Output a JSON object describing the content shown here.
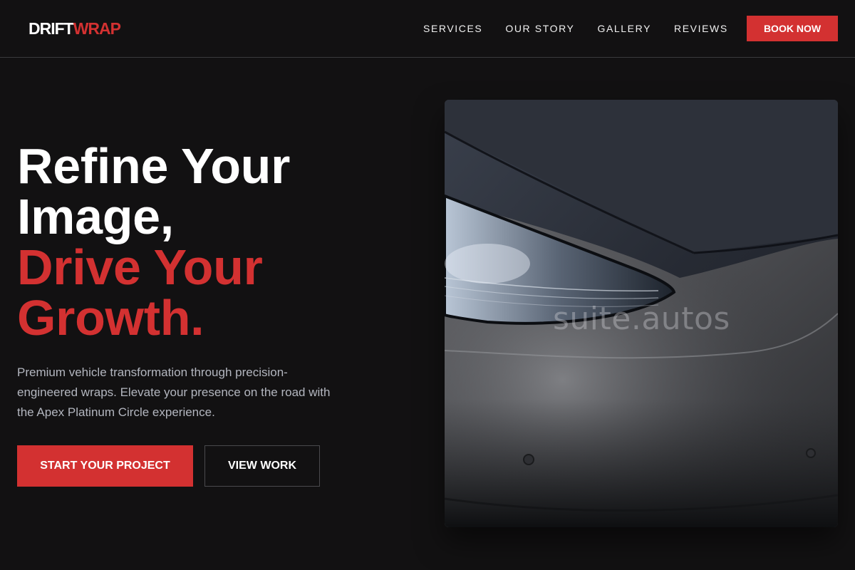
{
  "brand": {
    "part1": "DRIFT",
    "part2": "WRAP"
  },
  "nav": {
    "items": [
      {
        "label": "SERVICES"
      },
      {
        "label": "OUR STORY"
      },
      {
        "label": "GALLERY"
      },
      {
        "label": "REVIEWS"
      }
    ],
    "cta_label": "BOOK NOW"
  },
  "hero": {
    "title_lines": [
      "Refine Your",
      "Image,"
    ],
    "accent_lines": [
      "Drive Your",
      "Growth."
    ],
    "subtitle": "Premium vehicle transformation through precision-engineered wraps. Elevate your presence on the road with the Apex Platinum Circle experience.",
    "primary_cta": "START YOUR PROJECT",
    "secondary_cta": "VIEW WORK",
    "image_watermark": "suite.autos"
  },
  "colors": {
    "accent": "#d33131",
    "background": "#121112",
    "text": "#ffffff",
    "muted_text": "#b3b6bf"
  }
}
